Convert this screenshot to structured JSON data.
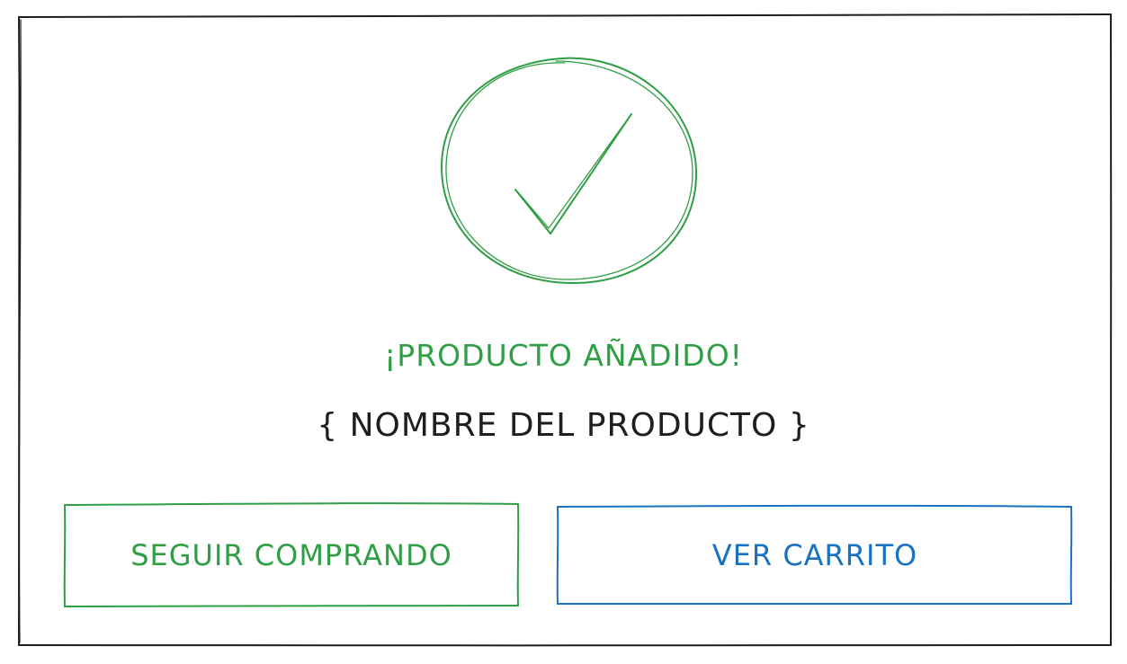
{
  "colors": {
    "frame": "#1e1e1e",
    "success": "#2f9e44",
    "primary": "#1971c2",
    "text": "#1e1e1e"
  },
  "success_icon": "check-circle-icon",
  "dialog": {
    "title": "¡PRODUCTO AÑADIDO!",
    "product_name": "{ NOMBRE DEL PRODUCTO }",
    "continue_label": "SEGUIR COMPRANDO",
    "cart_label": "VER CARRITO"
  }
}
